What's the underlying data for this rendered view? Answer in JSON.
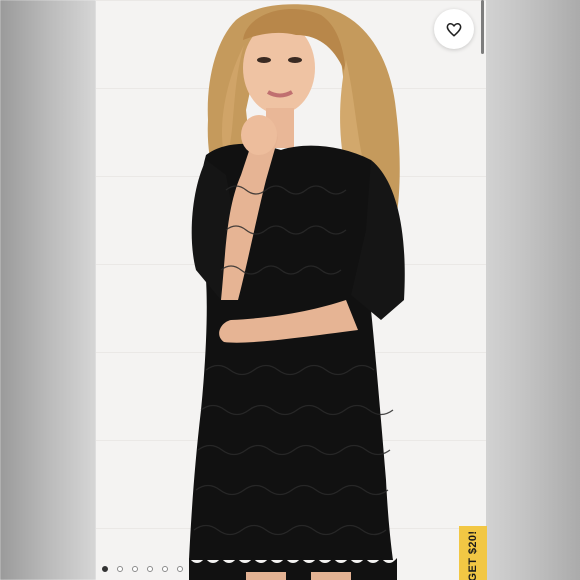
{
  "listing": {
    "image_count": 6,
    "active_image_index": 0
  },
  "like_button": {
    "icon": "heart-outline-icon"
  },
  "promo_tab": {
    "text": "GET $20!",
    "color": "#f2c744"
  },
  "colors": {
    "dress": "#111111",
    "hair": "#c79a5a",
    "skin": "#e8b99a",
    "background": "#f4f3f2"
  }
}
